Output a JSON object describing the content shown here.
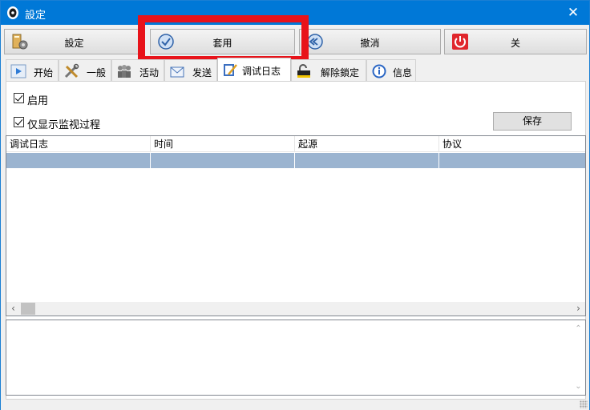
{
  "window": {
    "title": "設定",
    "close_glyph": "✕"
  },
  "toolbar": {
    "buttons": [
      {
        "label": "設定",
        "icon": "settings-icon"
      },
      {
        "label": "套用",
        "icon": "apply-check-icon"
      },
      {
        "label": "撤消",
        "icon": "undo-icon"
      },
      {
        "label": "关",
        "icon": "power-icon"
      }
    ]
  },
  "highlight_color": "#e8131a",
  "tabs": [
    {
      "label": "开始",
      "icon": "play-icon"
    },
    {
      "label": "一般",
      "icon": "tools-icon"
    },
    {
      "label": "活动",
      "icon": "people-icon"
    },
    {
      "label": "发送",
      "icon": "send-envelope-icon"
    },
    {
      "label": "调试日志",
      "icon": "debug-log-icon",
      "active": true
    },
    {
      "label": "解除鎖定",
      "icon": "unlock-icon"
    },
    {
      "label": "信息",
      "icon": "info-icon"
    }
  ],
  "debug": {
    "enable_label": "启用",
    "enable_checked": true,
    "monitor_only_label": "仅显示监视过程",
    "monitor_only_checked": true,
    "save_label": "保存"
  },
  "log_table": {
    "columns": [
      "调试日志",
      "时间",
      "起源",
      "协议"
    ],
    "rows": [
      [
        "",
        "",
        "",
        ""
      ]
    ],
    "selected_row": 0
  },
  "scroll": {
    "left": "‹",
    "right": "›",
    "up": "⌃",
    "down": "⌄"
  },
  "colors": {
    "titlebar": "#0078d7",
    "selected_row": "#9bb4d0"
  }
}
